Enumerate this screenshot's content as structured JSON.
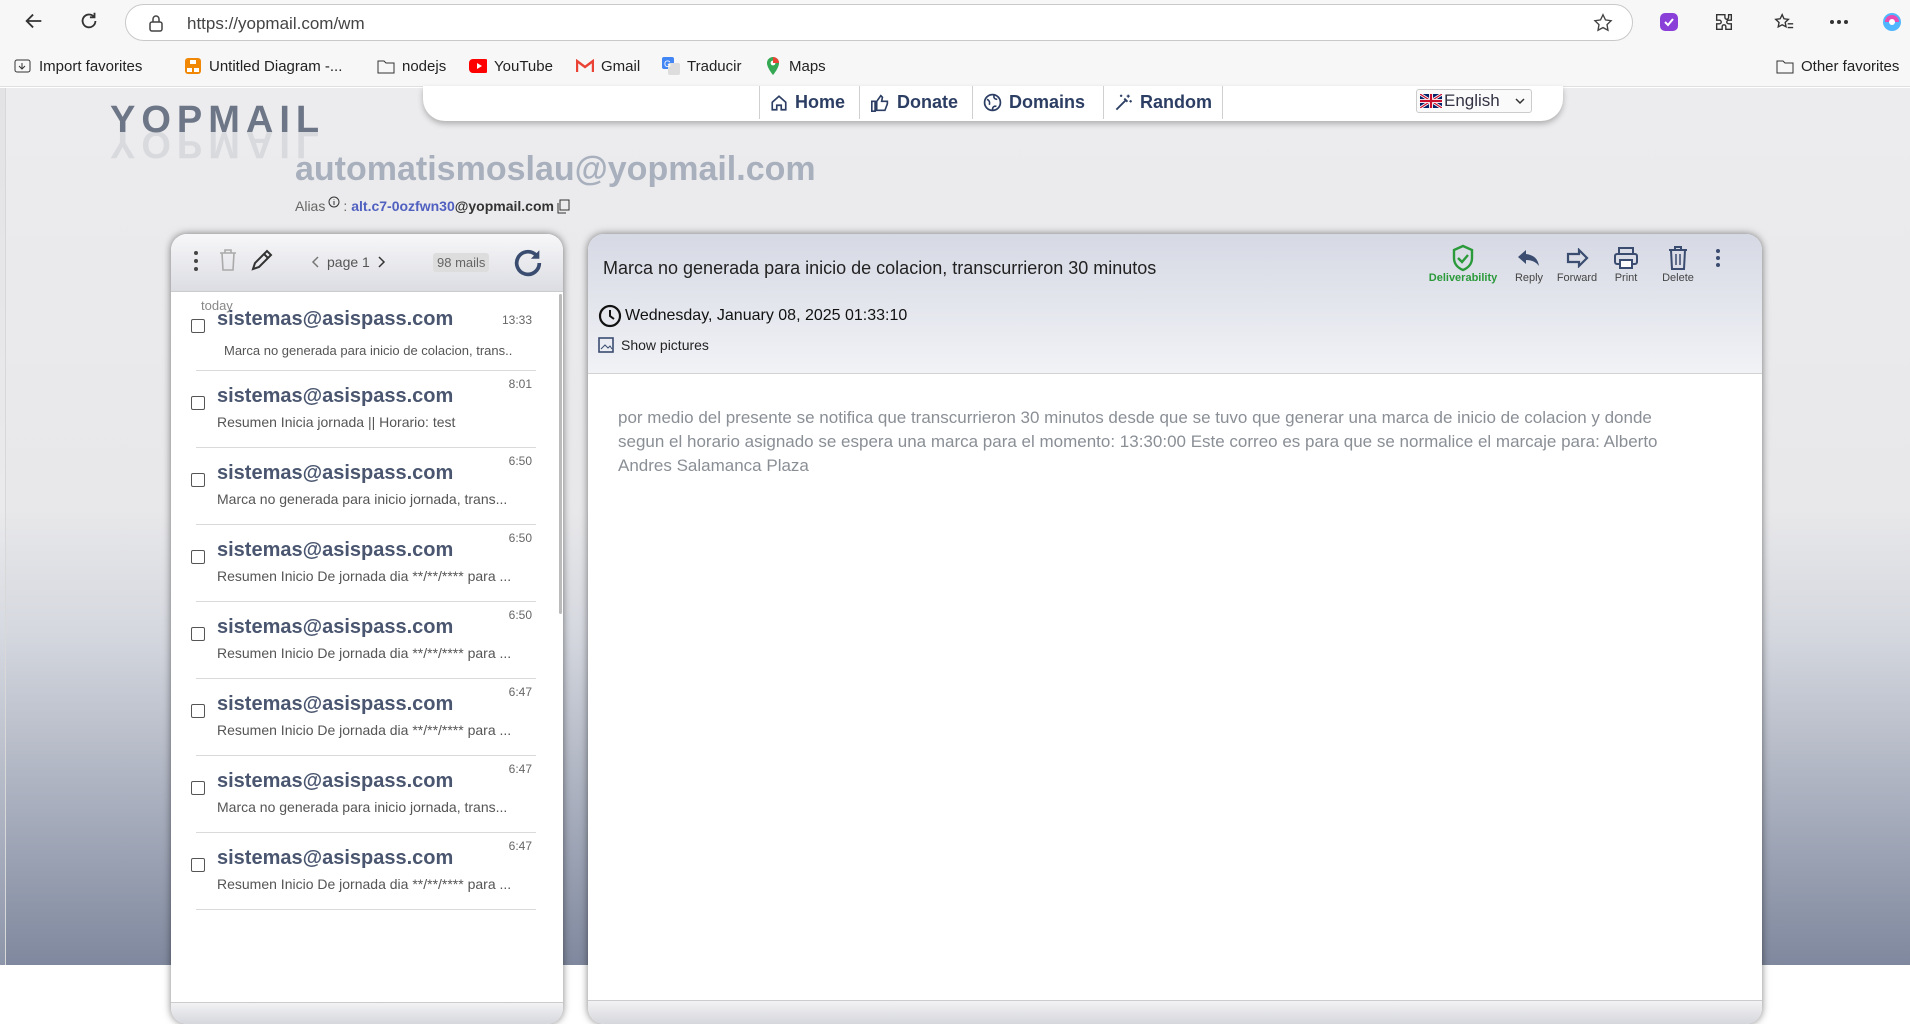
{
  "browser": {
    "url": "https://yopmail.com/wm",
    "bookmarks": [
      {
        "label": "Import favorites",
        "icon": "import-icon"
      },
      {
        "label": "Untitled Diagram -...",
        "icon": "drawio-icon"
      },
      {
        "label": "nodejs",
        "icon": "folder-icon"
      },
      {
        "label": "YouTube",
        "icon": "youtube-icon"
      },
      {
        "label": "Gmail",
        "icon": "gmail-icon"
      },
      {
        "label": "Traducir",
        "icon": "translate-icon"
      },
      {
        "label": "Maps",
        "icon": "maps-icon"
      }
    ],
    "other_favorites": "Other favorites"
  },
  "header": {
    "logo_text": "YOPMAIL",
    "menu": [
      "Home",
      "Donate",
      "Domains",
      "Random"
    ],
    "language": "English"
  },
  "inbox": {
    "address": "automatismoslau@yopmail.com",
    "alias_label": "Alias",
    "alias_name": "alt.c7-0ozfwn30",
    "alias_domain": "@yopmail.com"
  },
  "list": {
    "page_label": "page 1",
    "count": "98 mails",
    "group_label": "today",
    "rows": [
      {
        "from": "sistemas@asispass.com",
        "subject": "Marca no generada para inicio de colacion, trans..",
        "time": "13:33"
      },
      {
        "from": "sistemas@asispass.com",
        "subject": "Resumen Inicia jornada || Horario: test",
        "time": "8:01"
      },
      {
        "from": "sistemas@asispass.com",
        "subject": "Marca no generada para inicio jornada, trans...",
        "time": "6:50"
      },
      {
        "from": "sistemas@asispass.com",
        "subject": "Resumen Inicio De jornada dia **/**/**** para ...",
        "time": "6:50"
      },
      {
        "from": "sistemas@asispass.com",
        "subject": "Resumen Inicio De jornada dia **/**/**** para ...",
        "time": "6:50"
      },
      {
        "from": "sistemas@asispass.com",
        "subject": "Resumen Inicio De jornada dia **/**/**** para ...",
        "time": "6:47"
      },
      {
        "from": "sistemas@asispass.com",
        "subject": "Marca no generada para inicio jornada, trans...",
        "time": "6:47"
      },
      {
        "from": "sistemas@asispass.com",
        "subject": "Resumen Inicio De jornada dia **/**/**** para ...",
        "time": "6:47"
      }
    ]
  },
  "message": {
    "subject": "Marca no generada para inicio de colacion, transcurrieron 30 minutos",
    "date": "Wednesday, January 08, 2025 01:33:10",
    "show_pictures": "Show pictures",
    "actions": [
      "Deliverability",
      "Reply",
      "Forward",
      "Print",
      "Delete"
    ],
    "body": "por medio del presente se notifica que transcurrieron 30 minutos desde que se tuvo que generar una marca de inicio de colacion y donde segun el horario asignado se espera una marca para el momento:  13:30:00   Este correo es para que se normalice el marcaje para: Alberto Andres Salamanca Plaza"
  },
  "colors": {
    "accent": "#2c3e63",
    "deliverability": "#2b9a3a",
    "alias_link": "#5060c0"
  }
}
